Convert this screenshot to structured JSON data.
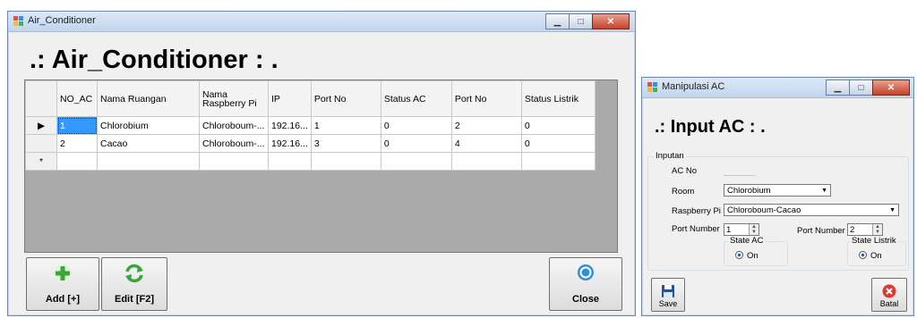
{
  "main_window": {
    "title": "Air_Conditioner",
    "heading": ".: Air_Conditioner : .",
    "columns": [
      "NO_AC",
      "Nama Ruangan",
      "Nama Raspberry Pi",
      "IP",
      "Port No",
      "Status AC",
      "Port No",
      "Status Listrik"
    ],
    "rows": [
      [
        "1",
        "Chlorobium",
        "Chloroboum-...",
        "192.16...",
        "1",
        "0",
        "2",
        "0"
      ],
      [
        "2",
        "Cacao",
        "Chloroboum-...",
        "192.16...",
        "3",
        "0",
        "4",
        "0"
      ]
    ],
    "new_row_marker": "*",
    "current_row_marker": "▶",
    "buttons": {
      "add": "Add [+]",
      "edit": "Edit [F2]",
      "close": "Close"
    }
  },
  "dialog": {
    "title": "Manipulasi AC",
    "heading": ".: Input AC : .",
    "group_label": "Inputan",
    "ac_no_label": "AC No",
    "room_label": "Room",
    "room_value": "Chlorobium",
    "raspberry_label": "Raspberry Pi",
    "raspberry_value": "Chloroboum-Cacao",
    "port_label_1": "Port Number",
    "port_value_1": "1",
    "port_label_2": "Port Number",
    "port_value_2": "2",
    "state_ac_label": "State AC",
    "state_ac_option": "On",
    "state_listrik_label": "State Listrik",
    "state_listrik_option": "On",
    "buttons": {
      "save": "Save",
      "cancel": "Batal"
    }
  },
  "colors": {
    "selection": "#3399ff",
    "close_red": "#c4432d",
    "title_bg": "#c2d5ee"
  }
}
